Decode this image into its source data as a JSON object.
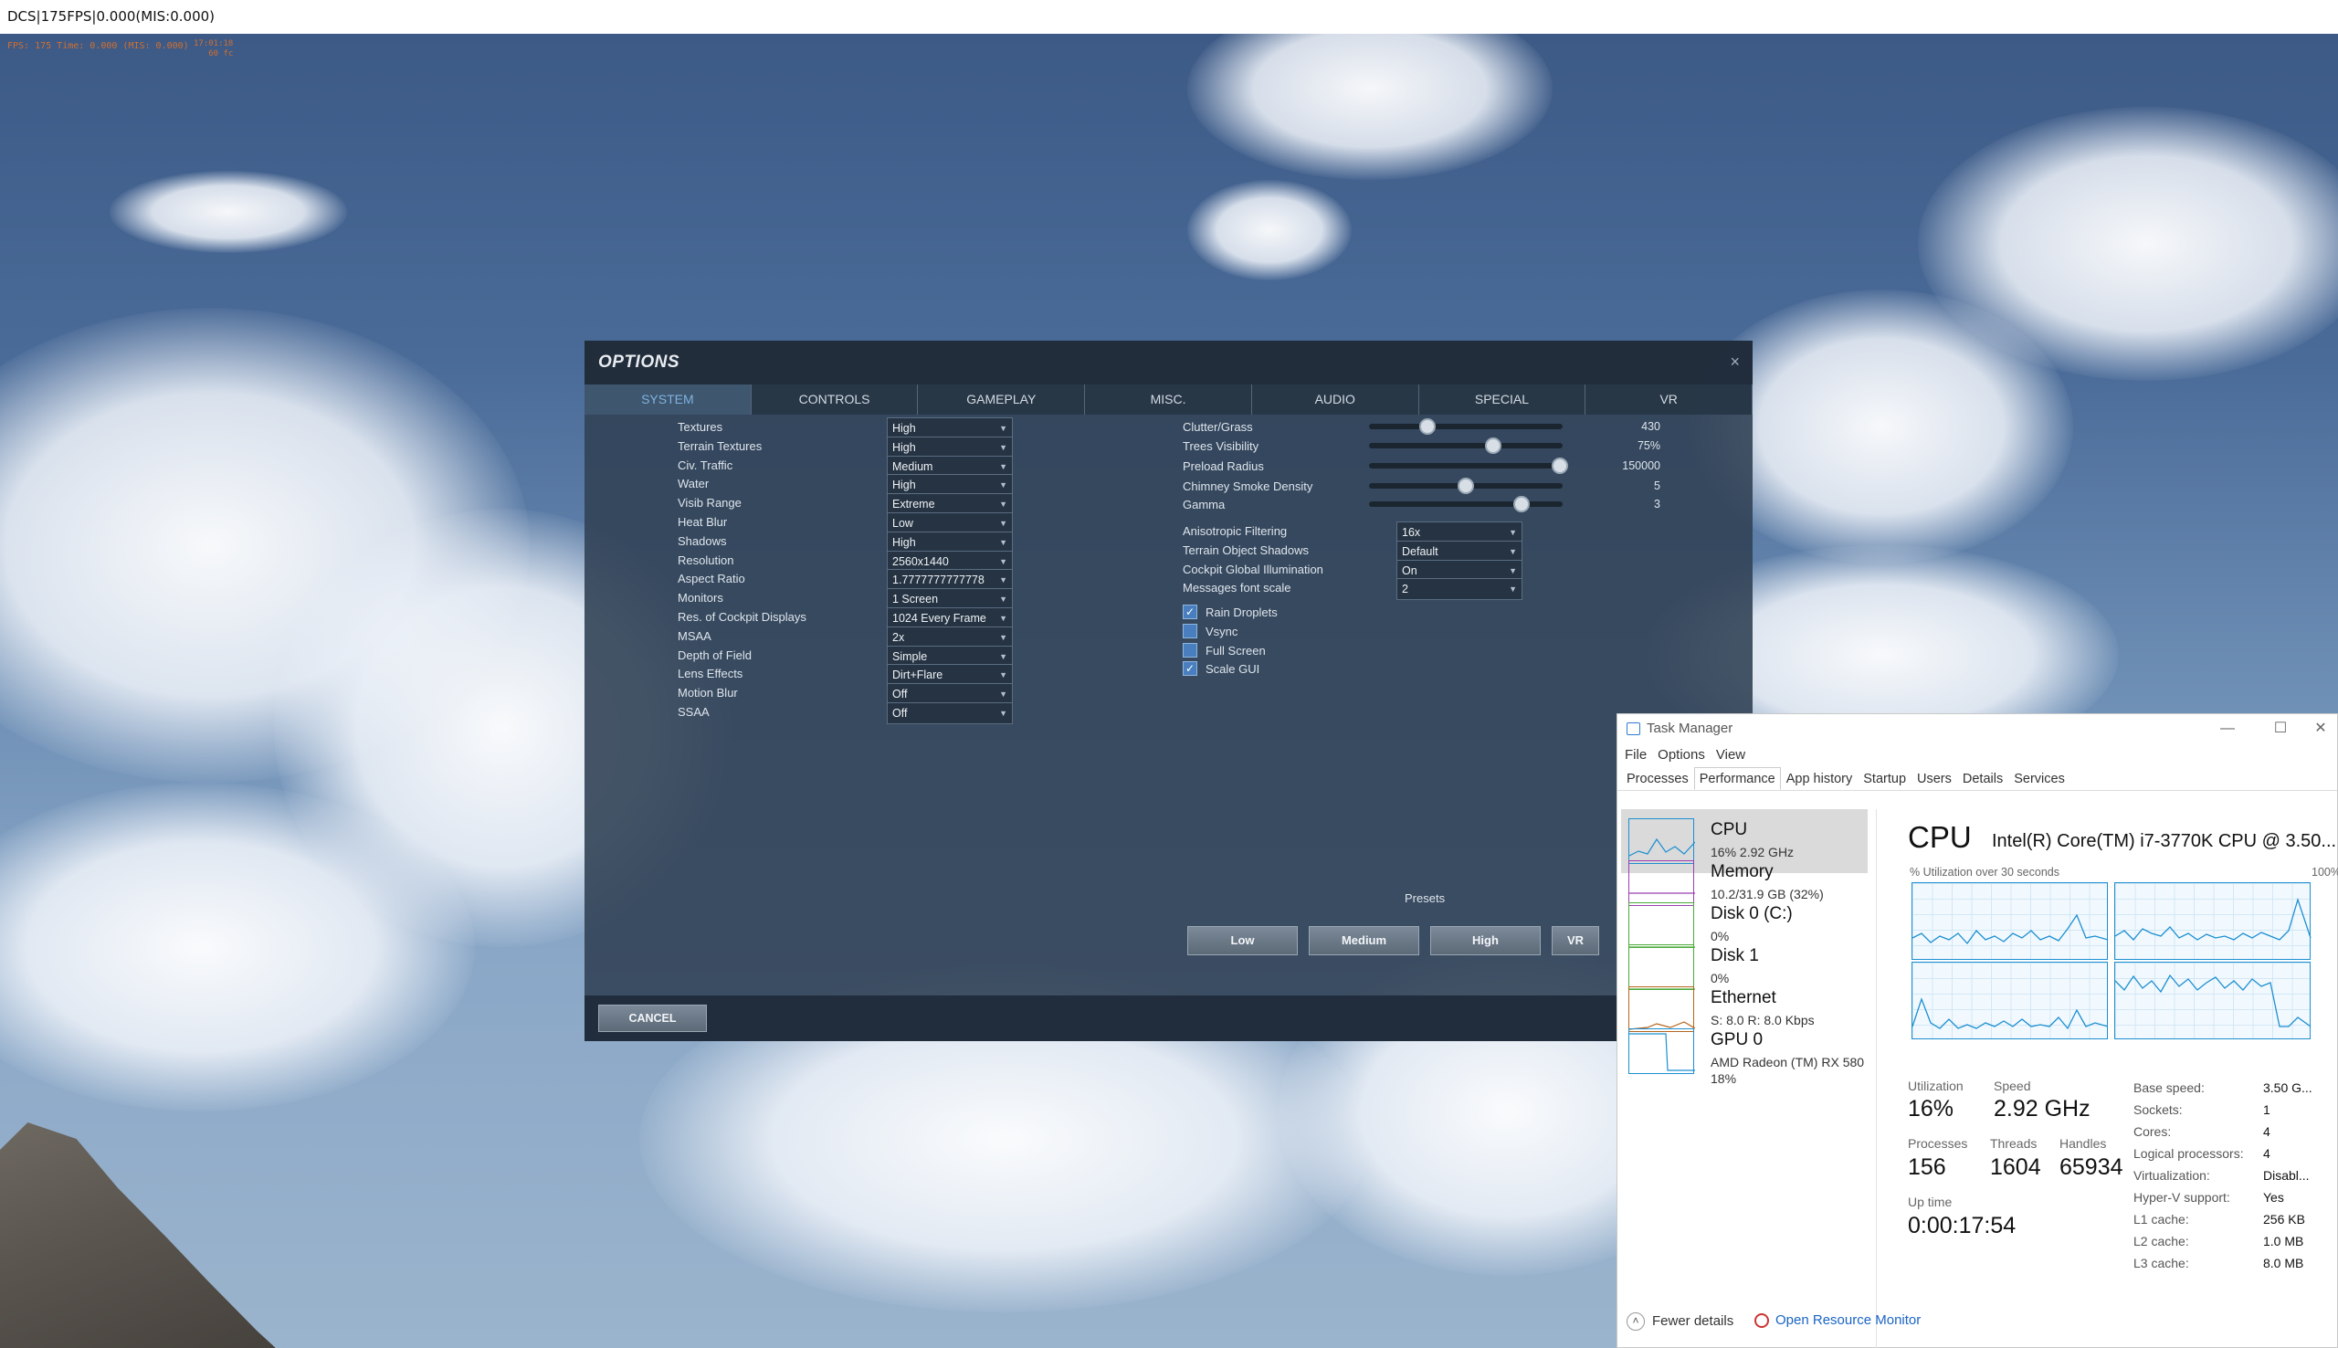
{
  "window_title": "DCS|175FPS|0.000(MIS:0.000)",
  "hud": {
    "fps_line": "FPS: 175 Time: 0.000 (MIS: 0.000)",
    "right_line1": "17:01:18",
    "right_line2": "60 fc"
  },
  "options": {
    "title": "OPTIONS",
    "close": "×",
    "tabs": [
      "SYSTEM",
      "CONTROLS",
      "GAMEPLAY",
      "MISC.",
      "AUDIO",
      "SPECIAL",
      "VR"
    ],
    "active_tab": "SYSTEM",
    "left_settings": [
      {
        "label": "Textures",
        "value": "High"
      },
      {
        "label": "Terrain Textures",
        "value": "High"
      },
      {
        "label": "Civ. Traffic",
        "value": "Medium"
      },
      {
        "label": "Water",
        "value": "High"
      },
      {
        "label": "Visib Range",
        "value": "Extreme"
      },
      {
        "label": "Heat Blur",
        "value": "Low"
      },
      {
        "label": "Shadows",
        "value": "High"
      },
      {
        "label": "Resolution",
        "value": "2560x1440"
      },
      {
        "label": "Aspect Ratio",
        "value": "1.7777777777778"
      },
      {
        "label": "Monitors",
        "value": "1 Screen"
      },
      {
        "label": "Res. of Cockpit Displays",
        "value": "1024 Every Frame"
      },
      {
        "label": "MSAA",
        "value": "2x"
      },
      {
        "label": "Depth of Field",
        "value": "Simple"
      },
      {
        "label": "Lens Effects",
        "value": "Dirt+Flare"
      },
      {
        "label": "Motion Blur",
        "value": "Off"
      },
      {
        "label": "SSAA",
        "value": "Off"
      }
    ],
    "sliders": [
      {
        "label": "Clutter/Grass",
        "value": "430",
        "level": 0.3
      },
      {
        "label": "Trees Visibility",
        "value": "75%",
        "level": 0.64
      },
      {
        "label": "Preload Radius",
        "value": "150000",
        "level": 0.985
      },
      {
        "label": "Chimney Smoke Density",
        "value": "5",
        "level": 0.5
      },
      {
        "label": "Gamma",
        "value": "3",
        "level": 0.79
      }
    ],
    "right_settings": [
      {
        "label": "Anisotropic Filtering",
        "value": "16x"
      },
      {
        "label": "Terrain Object Shadows",
        "value": "Default"
      },
      {
        "label": "Cockpit Global Illumination",
        "value": "On"
      },
      {
        "label": "Messages font scale",
        "value": "2"
      }
    ],
    "checkboxes": [
      {
        "label": "Rain Droplets",
        "checked": true
      },
      {
        "label": "Vsync",
        "checked": false
      },
      {
        "label": "Full Screen",
        "checked": false
      },
      {
        "label": "Scale GUI",
        "checked": true
      }
    ],
    "presets_label": "Presets",
    "presets": [
      "Low",
      "Medium",
      "High",
      "VR"
    ],
    "cancel": "CANCEL"
  },
  "task_manager": {
    "title": "Task Manager",
    "controls": {
      "minimize": "—",
      "maximize": "☐",
      "close": "✕"
    },
    "menu": [
      "File",
      "Options",
      "View"
    ],
    "tabs": [
      "Processes",
      "Performance",
      "App history",
      "Startup",
      "Users",
      "Details",
      "Services"
    ],
    "active_tab": "Performance",
    "resources": [
      {
        "name": "CPU",
        "sub1": "16% 2.92 GHz",
        "sub2": "",
        "color": "#1b8fd1"
      },
      {
        "name": "Memory",
        "sub1": "10.2/31.9 GB (32%)",
        "sub2": "",
        "color": "#9b3fb0"
      },
      {
        "name": "Disk 0 (C:)",
        "sub1": "0%",
        "sub2": "",
        "color": "#4caa3b"
      },
      {
        "name": "Disk 1",
        "sub1": "0%",
        "sub2": "",
        "color": "#4caa3b"
      },
      {
        "name": "Ethernet",
        "sub1": "S: 8.0  R: 8.0 Kbps",
        "sub2": "",
        "color": "#b5651d"
      },
      {
        "name": "GPU 0",
        "sub1": "AMD Radeon (TM) RX 580",
        "sub2": "18%",
        "color": "#1b8fd1"
      }
    ],
    "cpu_heading": "CPU",
    "cpu_name": "Intel(R) Core(TM) i7-3770K CPU @ 3.50...",
    "util_caption": "% Utilization over 30 seconds",
    "util_max": "100%",
    "stats": {
      "utilization_label": "Utilization",
      "utilization": "16%",
      "speed_label": "Speed",
      "speed": "2.92 GHz",
      "processes_label": "Processes",
      "processes": "156",
      "threads_label": "Threads",
      "threads": "1604",
      "handles_label": "Handles",
      "handles": "65934",
      "uptime_label": "Up time",
      "uptime": "0:00:17:54"
    },
    "specs": [
      {
        "k": "Base speed:",
        "v": "3.50 G..."
      },
      {
        "k": "Sockets:",
        "v": "1"
      },
      {
        "k": "Cores:",
        "v": "4"
      },
      {
        "k": "Logical processors:",
        "v": "4"
      },
      {
        "k": "Virtualization:",
        "v": "Disabl..."
      },
      {
        "k": "Hyper-V support:",
        "v": "Yes"
      },
      {
        "k": "L1 cache:",
        "v": "256 KB"
      },
      {
        "k": "L2 cache:",
        "v": "1.0 MB"
      },
      {
        "k": "L3 cache:",
        "v": "8.0 MB"
      }
    ],
    "fewer_details": "Fewer details",
    "resource_monitor": "Open Resource Monitor"
  }
}
